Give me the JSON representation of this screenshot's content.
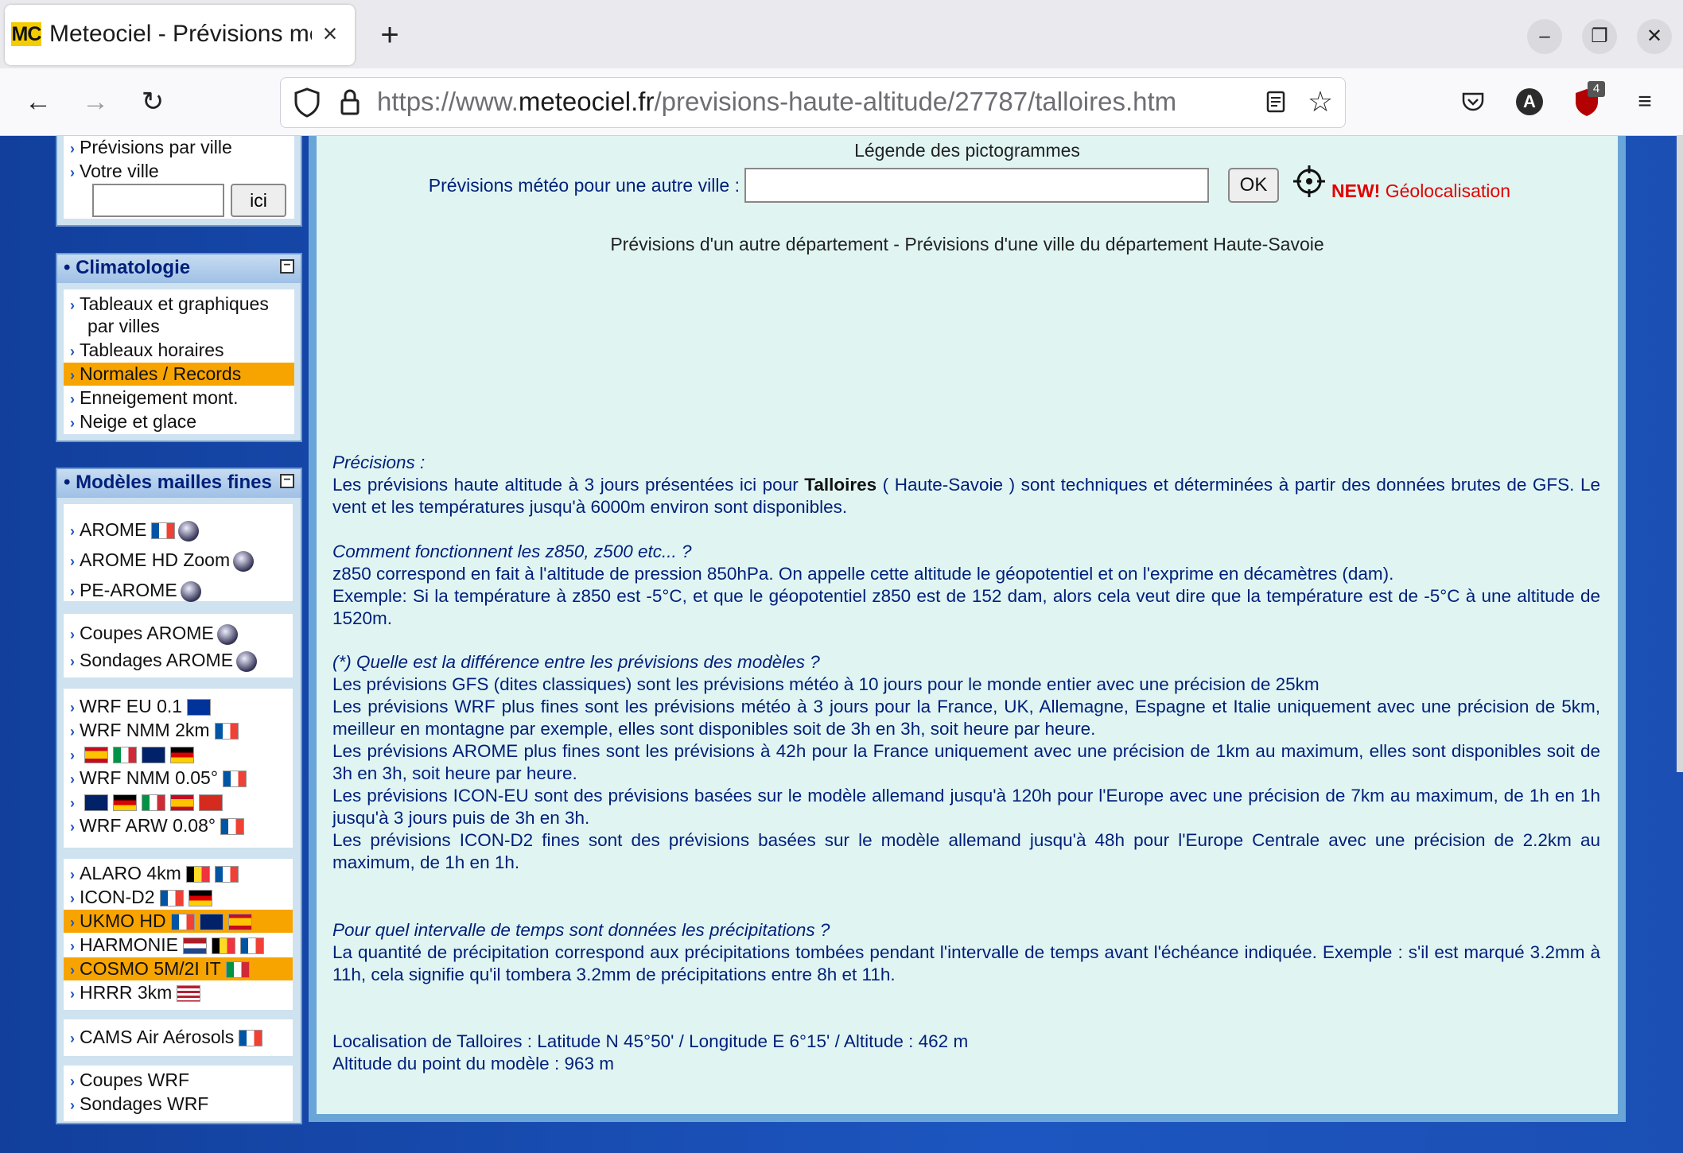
{
  "browser": {
    "tab_title": "Meteociel - Prévisions mé",
    "favicon_text": "MC",
    "tab_close": "×",
    "new_tab": "+",
    "url_prefix": "https://www.",
    "url_domain": "meteociel.fr",
    "url_path": "/previsions-haute-altitude/27787/talloires.htm",
    "ublock_badge": "4",
    "account_initial": "A"
  },
  "sidebar": {
    "top_items": [
      "Prévisions par ville",
      "Votre ville"
    ],
    "ici_button": "ici",
    "climatologie": {
      "title": "• Climatologie",
      "items": [
        {
          "label": "Tableaux et graphiques",
          "label2": "par villes",
          "hl": false
        },
        {
          "label": "Tableaux horaires",
          "hl": false
        },
        {
          "label": "Normales / Records",
          "hl": true
        },
        {
          "label": "Enneigement mont.",
          "hl": false
        },
        {
          "label": "Neige et glace",
          "hl": false
        }
      ]
    },
    "modeles": {
      "title": "• Modèles mailles fines",
      "group1": [
        "AROME",
        "AROME HD Zoom",
        "PE-AROME"
      ],
      "group2": [
        "Coupes AROME",
        "Sondages AROME"
      ],
      "group3": [
        "WRF EU 0.1",
        "WRF NMM 2km",
        "WRF NMM 0.05°",
        "WRF ARW 0.08°"
      ],
      "group4": [
        "ALARO 4km",
        "ICON-D2",
        "UKMO HD",
        "HARMONIE",
        "COSMO 5M/2I IT",
        "HRRR 3km"
      ],
      "group5": [
        "CAMS Air Aérosols"
      ],
      "group6": [
        "Coupes WRF",
        "Sondages WRF"
      ]
    }
  },
  "main": {
    "legend_link": "Légende des pictogrammes",
    "search_label": "Prévisions météo pour une autre ville :",
    "ok_button": "OK",
    "new_label": "NEW!",
    "geoloc_label": "Géolocalisation",
    "dept_links": "Prévisions d'un autre département - Prévisions d'une ville du département Haute-Savoie",
    "precisions_title": "Précisions :",
    "precisions_text_a": "Les prévisions haute altitude à 3 jours présentées ici pour",
    "precisions_city": "Talloires",
    "precisions_text_b": "( Haute-Savoie ) sont techniques et déterminées à partir des données brutes de GFS. Le vent et les températures jusqu'à 6000m environ sont disponibles.",
    "z850_title": "Comment fonctionnent les z850, z500 etc... ?",
    "z850_p1": "z850 correspond en fait à l'altitude de pression 850hPa. On appelle cette altitude le géopotentiel et on l'exprime en décamètres (dam).",
    "z850_p2": "Exemple: Si la température à z850 est -5°C, et que le géopotentiel z850 est de 152 dam, alors cela veut dire que la température est de -5°C à une altitude de 1520m.",
    "diff_title": "(*) Quelle est la différence entre les prévisions des modèles ?",
    "diff_gfs": "Les prévisions GFS (dites classiques) sont les prévisions météo à 10 jours pour le monde entier avec une précision de 25km",
    "diff_wrf": "Les prévisions WRF plus fines sont les prévisions météo à 3 jours pour la France, UK, Allemagne, Espagne et Italie uniquement avec une précision de 5km, meilleur en montagne par exemple, elles sont disponibles soit de 3h en 3h, soit heure par heure.",
    "diff_arome": "Les prévisions AROME plus fines sont les prévisions à 42h pour la France uniquement avec une précision de 1km au maximum, elles sont disponibles soit de 3h en 3h, soit heure par heure.",
    "diff_iconeu": "Les prévisions ICON-EU sont des prévisions basées sur le modèle allemand jusqu'à 120h pour l'Europe avec une précision de 7km au maximum, de 1h en 1h jusqu'à 3 jours puis de 3h en 3h.",
    "diff_icond2": "Les prévisions ICON-D2 fines sont des prévisions basées sur le modèle allemand jusqu'à 48h pour l'Europe Centrale avec une précision de 2.2km au maximum, de 1h en 1h.",
    "precip_title": "Pour quel intervalle de temps sont données les précipitations ?",
    "precip_text": "La quantité de précipitation correspond aux précipitations tombées pendant l'intervalle de temps avant l'échéance indiquée. Exemple : s'il est marqué 3.2mm à 11h, cela signifie qu'il tombera 3.2mm de précipitations entre 8h et 11h.",
    "localisation": "Localisation de Talloires : Latitude N 45°50' / Longitude E 6°15' / Altitude : 462 m",
    "altitude_modele": "Altitude du point du modèle : 963 m"
  }
}
